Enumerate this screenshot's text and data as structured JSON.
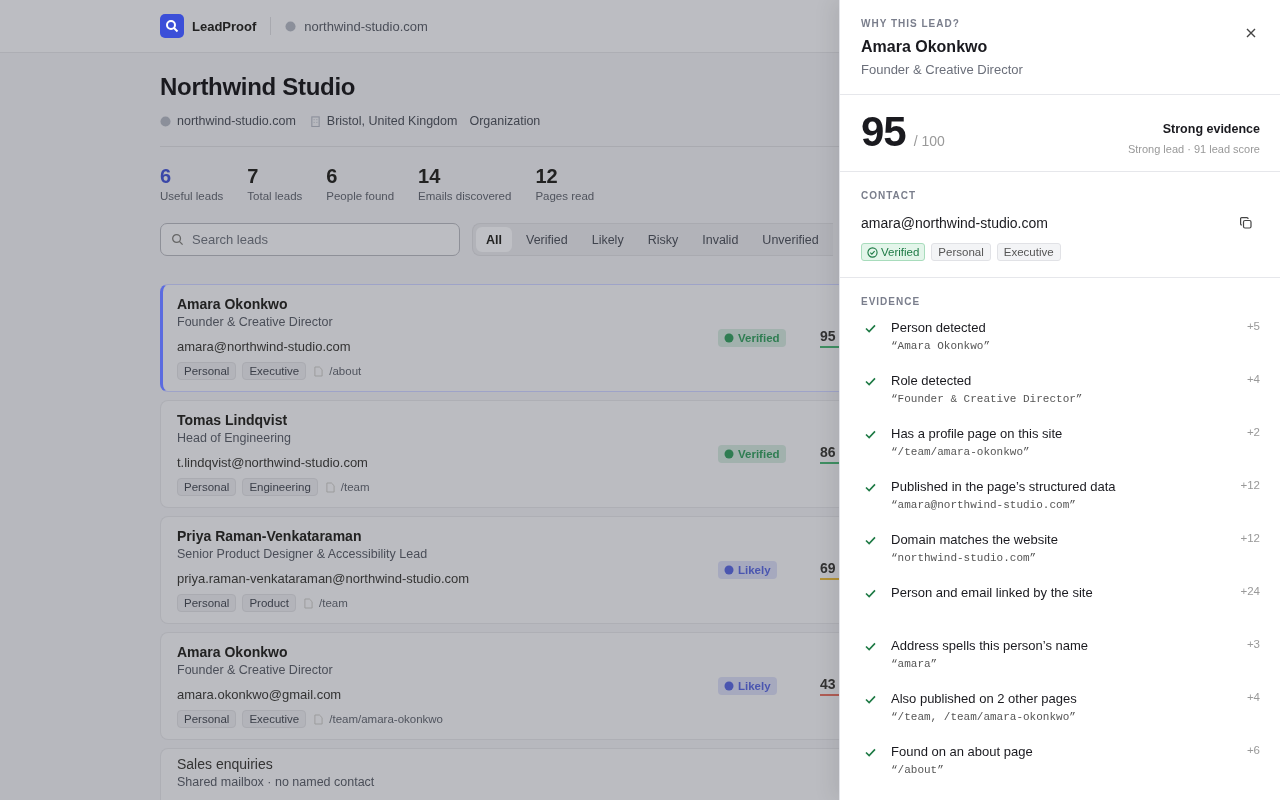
{
  "app": {
    "name": "LeadProof",
    "domain": "northwind-studio.com"
  },
  "company": {
    "name": "Northwind Studio",
    "website": "northwind-studio.com",
    "location": "Bristol, United Kingdom",
    "type": "Organization"
  },
  "stats": [
    {
      "value": "6",
      "label": "Useful leads",
      "highlight": true
    },
    {
      "value": "7",
      "label": "Total leads",
      "highlight": false
    },
    {
      "value": "6",
      "label": "People found",
      "highlight": false
    },
    {
      "value": "14",
      "label": "Emails discovered",
      "highlight": false
    },
    {
      "value": "12",
      "label": "Pages read",
      "highlight": false
    }
  ],
  "search": {
    "placeholder": "Search leads"
  },
  "filters": [
    {
      "label": "All",
      "selected": true
    },
    {
      "label": "Verified",
      "selected": false
    },
    {
      "label": "Likely",
      "selected": false
    },
    {
      "label": "Risky",
      "selected": false
    },
    {
      "label": "Invalid",
      "selected": false
    },
    {
      "label": "Unverified",
      "selected": false
    }
  ],
  "leads": [
    {
      "name": "Amara Okonkwo",
      "role": "Founder & Creative Director",
      "email": "amara@northwind-studio.com",
      "tags": [
        "Personal",
        "Executive"
      ],
      "source": "/about",
      "status": {
        "text": "Verified",
        "color": "#2f7d52"
      },
      "score": {
        "text": "95",
        "color": "#3f8f63"
      },
      "selected": true
    },
    {
      "name": "Tomas Lindqvist",
      "role": "Head of Engineering",
      "email": "t.lindqvist@northwind-studio.com",
      "tags": [
        "Personal",
        "Engineering"
      ],
      "source": "/team",
      "status": {
        "text": "Verified",
        "color": "#2f7d52"
      },
      "score": {
        "text": "86",
        "color": "#3f8f63"
      },
      "selected": false
    },
    {
      "name": "Priya Raman-Venkataraman",
      "role": "Senior Product Designer & Accessibility Lead",
      "email": "priya.raman-venkataraman@northwind-studio.com",
      "tags": [
        "Personal",
        "Product"
      ],
      "source": "/team",
      "status": {
        "text": "Likely",
        "color": "#4a55b0"
      },
      "score": {
        "text": "69",
        "color": "#b39238"
      },
      "selected": false
    },
    {
      "name": "Amara Okonkwo",
      "role": "Founder & Creative Director",
      "email": "amara.okonkwo@gmail.com",
      "tags": [
        "Personal",
        "Executive"
      ],
      "source": "/team/amara-okonkwo",
      "status": {
        "text": "Likely",
        "color": "#4a55b0"
      },
      "score": {
        "text": "43",
        "color": "#b05d55"
      },
      "selected": false
    }
  ],
  "shared_lead": {
    "name": "Sales enquiries",
    "note": "Shared mailbox · no named contact"
  },
  "panel": {
    "eyebrow": "WHY THIS LEAD?",
    "name": "Amara Okonkwo",
    "role": "Founder & Creative Director",
    "score": "95",
    "score_max": "/ 100",
    "verdict": "Strong evidence",
    "verdict_note": "Strong lead · 91 lead score",
    "contact_heading": "CONTACT",
    "email": "amara@northwind-studio.com",
    "status": "Verified",
    "tags": [
      "Personal",
      "Executive"
    ],
    "evidence_heading": "EVIDENCE",
    "evidence": [
      {
        "title": "Person detected",
        "quote": "“Amara Okonkwo”",
        "points": "+5"
      },
      {
        "title": "Role detected",
        "quote": "“Founder & Creative Director”",
        "points": "+4"
      },
      {
        "title": "Has a profile page on this site",
        "quote": "“/team/amara-okonkwo”",
        "points": "+2"
      },
      {
        "title": "Published in the page’s structured data",
        "quote": "“amara@northwind-studio.com”",
        "points": "+12"
      },
      {
        "title": "Domain matches the website",
        "quote": "“northwind-studio.com”",
        "points": "+12"
      },
      {
        "title": "Person and email linked by the site",
        "points": "+24"
      },
      {
        "title": "Address spells this person’s name",
        "quote": "“amara”",
        "points": "+3"
      },
      {
        "title": "Also published on 2 other pages",
        "quote": "“/team, /team/amara-okonkwo”",
        "points": "+4"
      },
      {
        "title": "Found on an about page",
        "quote": "“/about”",
        "points": "+6"
      }
    ]
  }
}
